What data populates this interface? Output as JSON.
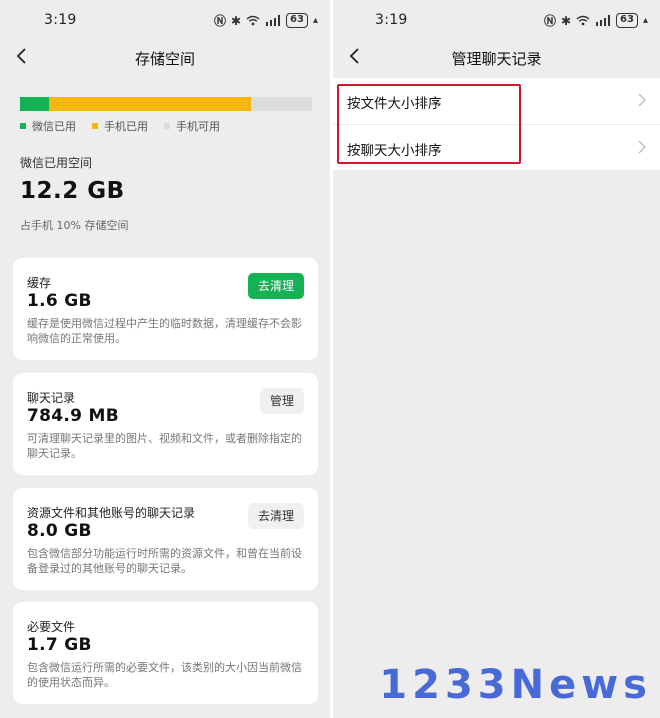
{
  "left": {
    "status": {
      "time": "3:19",
      "battery": "63"
    },
    "nav": {
      "title": "存储空间"
    },
    "storage_bar": {
      "wechat_used_fraction": 0.1,
      "phone_used_fraction": 0.69,
      "colors": {
        "wechat": "#14b255",
        "phone": "#f5b70d",
        "free": "#dcdcdc"
      }
    },
    "legend": [
      "微信已用",
      "手机已用",
      "手机可用"
    ],
    "summary": {
      "label": "微信已用空间",
      "value": "12.2 GB",
      "note": "占手机 10% 存储空间"
    },
    "cards": [
      {
        "title": "缓存",
        "size": "1.6 GB",
        "desc": "缓存是使用微信过程中产生的临时数据，清理缓存不会影响微信的正常使用。",
        "button": "去清理"
      },
      {
        "title": "聊天记录",
        "size": "784.9 MB",
        "desc": "可清理聊天记录里的图片、视频和文件，或者删除指定的聊天记录。",
        "button": "管理"
      },
      {
        "title": "资源文件和其他账号的聊天记录",
        "size": "8.0 GB",
        "desc": "包含微信部分功能运行时所需的资源文件，和曾在当前设备登录过的其他账号的聊天记录。",
        "button": "去清理"
      },
      {
        "title": "必要文件",
        "size": "1.7 GB",
        "desc": "包含微信运行所需的必要文件，该类别的大小因当前微信的使用状态而异。"
      }
    ]
  },
  "right": {
    "status": {
      "time": "3:19",
      "battery": "63"
    },
    "nav": {
      "title": "管理聊天记录"
    },
    "list": [
      {
        "label": "按文件大小排序"
      },
      {
        "label": "按聊天大小排序"
      }
    ],
    "highlight_color": "#d0182a"
  },
  "watermark": "1233News"
}
